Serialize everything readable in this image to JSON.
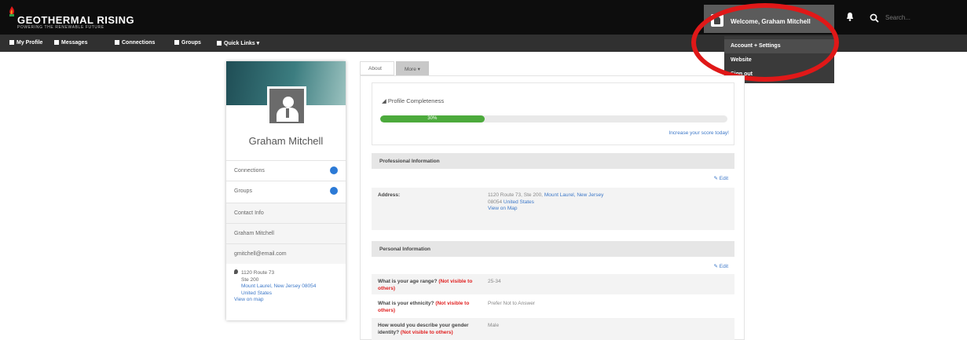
{
  "brand": {
    "name": "GEOTHERMAL RISING",
    "tagline": "POWERING THE RENEWABLE FUTURE",
    "accent": "#e01818"
  },
  "header": {
    "welcome": "Welcome, Graham Mitchell",
    "search_placeholder": "Search..."
  },
  "nav": {
    "items": [
      {
        "label": "My Profile",
        "icon": "profile-icon"
      },
      {
        "label": "Messages",
        "icon": "envelope-icon"
      },
      {
        "label": "Connections",
        "icon": "connections-icon"
      },
      {
        "label": "Groups",
        "icon": "groups-icon"
      },
      {
        "label": "Quick Links ▾",
        "icon": "link-icon"
      }
    ]
  },
  "account_menu": {
    "items": [
      {
        "label": "Account + Settings"
      },
      {
        "label": "Website"
      },
      {
        "label": "Sign out"
      }
    ]
  },
  "profile_card": {
    "name": "Graham Mitchell",
    "rows": [
      {
        "label": "Connections"
      },
      {
        "label": "Groups"
      },
      {
        "label": "Contact Info"
      },
      {
        "label": "Graham Mitchell"
      },
      {
        "label": "gmitchell@email.com"
      }
    ],
    "address_lines": [
      "1120 Route 73",
      "Ste 200"
    ],
    "address_link_lines": [
      "Mount Laurel, New Jersey 08054",
      "United States",
      "View on map"
    ]
  },
  "tabs": {
    "about": "About",
    "more": "More ▾"
  },
  "completeness": {
    "title": "Profile Completeness",
    "percent_label": "30%",
    "percent": 30,
    "increase_link": "Increase your score today!"
  },
  "professional": {
    "header": "Professional Information",
    "edit": "Edit",
    "address_label": "Address:",
    "address_value": "1120 Route 73, Ste 200,",
    "address_city": "Mount Laurel, New Jersey",
    "address_zip": "08054",
    "address_country": "United States",
    "address_map": "View on Map"
  },
  "personal": {
    "header": "Personal Information",
    "edit": "Edit",
    "rows": [
      {
        "q": "What is your age range?",
        "note": "(Not visible to others)",
        "a": "25-34"
      },
      {
        "q": "What is your ethnicity?",
        "note": "(Not visible to others)",
        "a": "Prefer Not to Answer"
      },
      {
        "q": "How would you describe your gender identity?",
        "note": "(Not visible to others)",
        "a": "Male"
      }
    ]
  }
}
